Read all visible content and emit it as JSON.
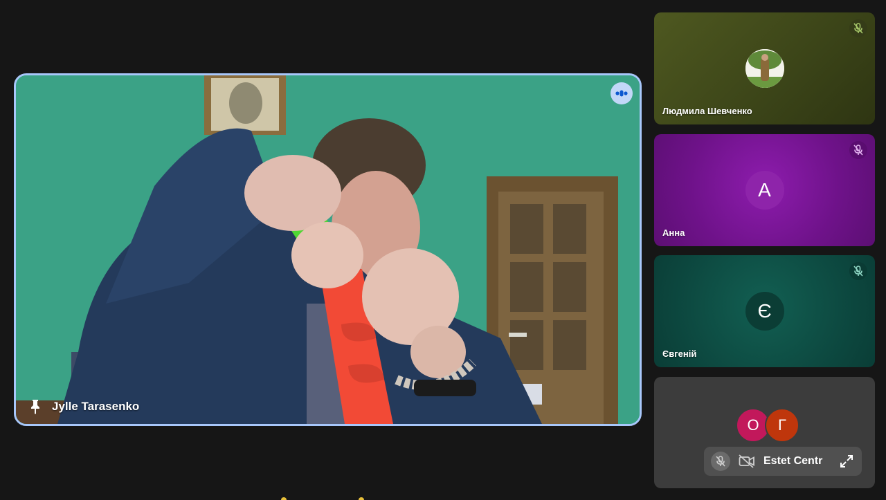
{
  "main": {
    "participant_name": "Jylle Tarasenko",
    "pinned": true,
    "speaking": true,
    "accent_color": "#a8c7fa"
  },
  "tiles": [
    {
      "name": "Людмила Шевченко",
      "avatar_type": "photo",
      "muted": true,
      "background": "#4e5820"
    },
    {
      "name": "Анна",
      "avatar_letter": "А",
      "avatar_color": "#8e24aa",
      "muted": true,
      "background": "#6e1289"
    },
    {
      "name": "Євгеній",
      "avatar_letter": "Є",
      "avatar_color": "#0b4d41",
      "muted": true,
      "background": "#0d4a41"
    }
  ],
  "others": {
    "avatars": [
      {
        "letter": "О",
        "color": "#c2185b"
      },
      {
        "letter": "Г",
        "color": "#bf360c"
      }
    ],
    "label": "Estet Centr",
    "icons": [
      "mic-off-icon",
      "camera-off-icon",
      "expand-icon"
    ]
  }
}
